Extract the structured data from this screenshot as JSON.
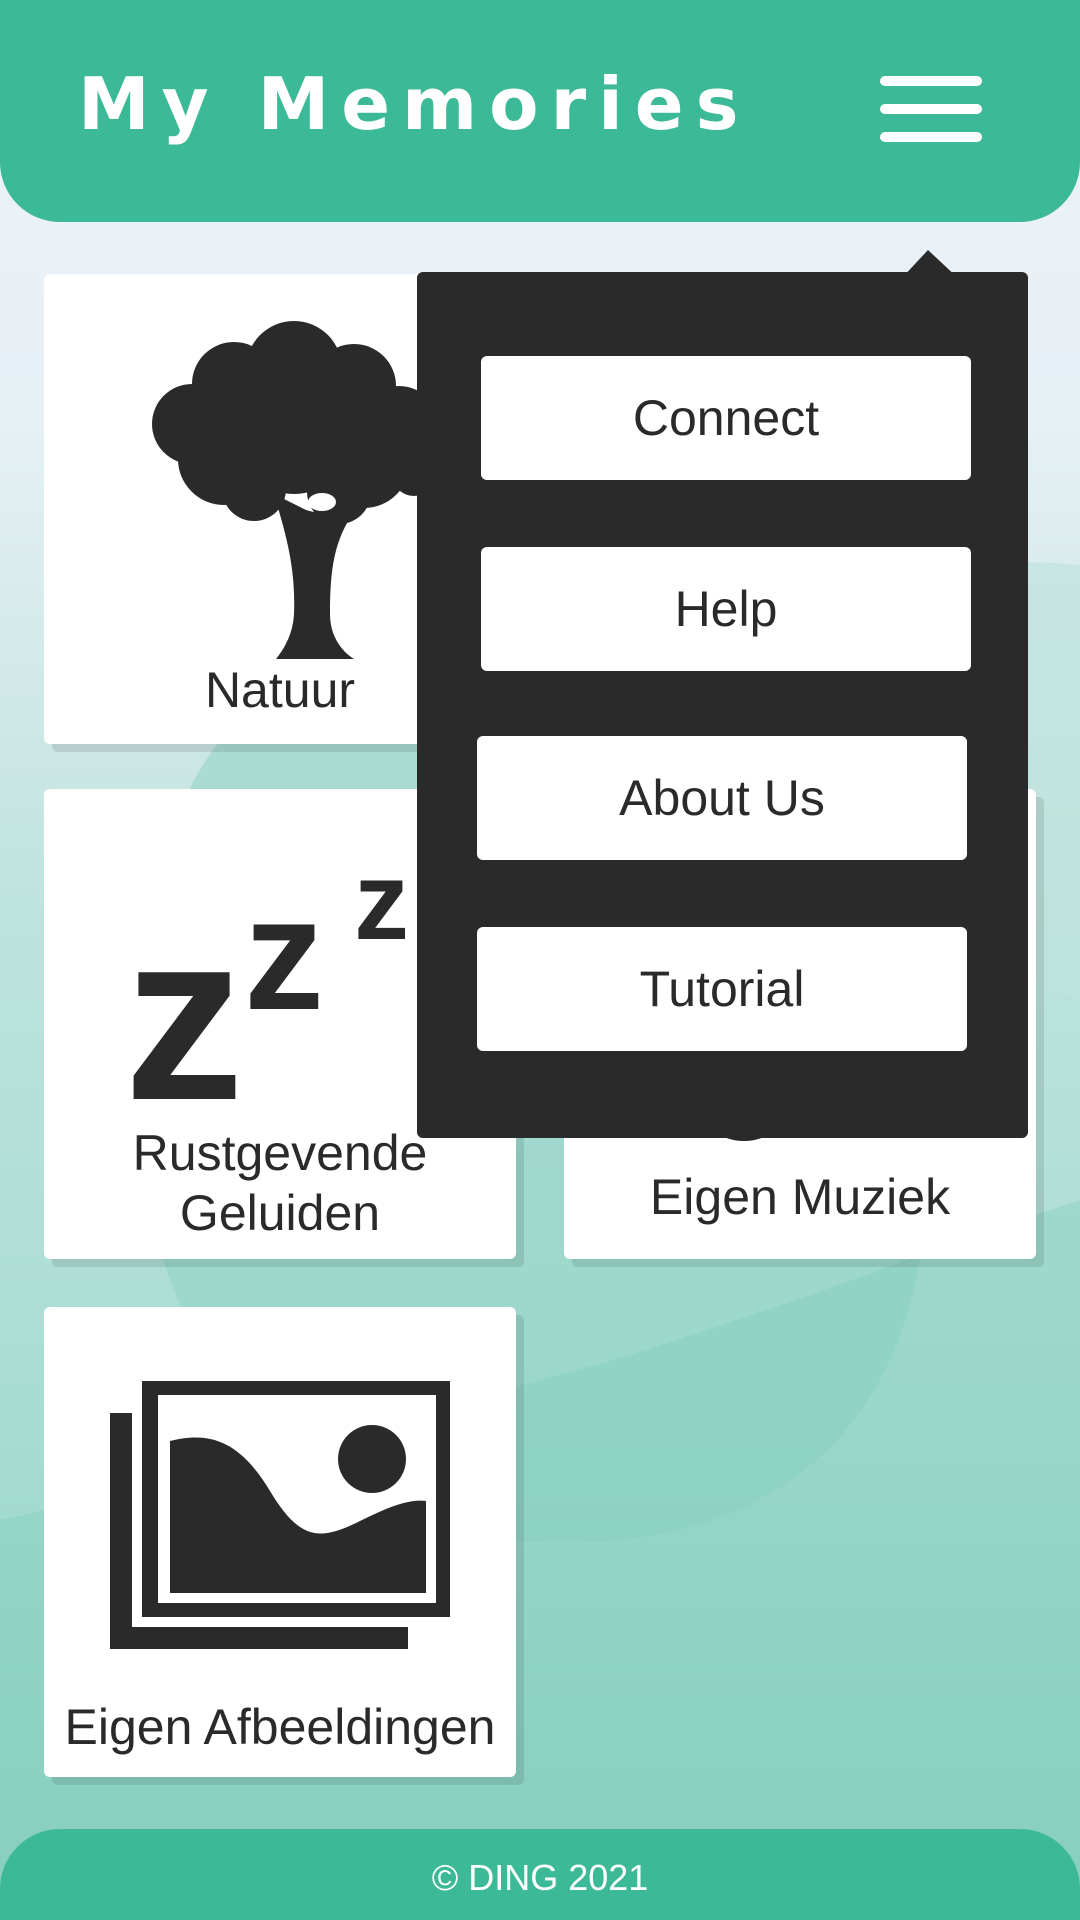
{
  "header": {
    "title": "My Memories",
    "menu_icon": "hamburger-menu-icon"
  },
  "tiles": [
    {
      "label": "Natuur",
      "icon": "tree-icon"
    },
    {
      "label_line1": "Rustgevende",
      "label_line2": "Geluiden",
      "icon": "sleep-zzz-icon"
    },
    {
      "label": "Eigen Muziek",
      "icon": "music-note-icon"
    },
    {
      "label": "Eigen Afbeeldingen",
      "icon": "image-gallery-icon"
    }
  ],
  "menu": {
    "items": [
      {
        "label": "Connect"
      },
      {
        "label": "Help"
      },
      {
        "label": "About Us"
      },
      {
        "label": "Tutorial"
      }
    ]
  },
  "footer": {
    "text": "© DING 2021"
  },
  "colors": {
    "brand": "#3cb996",
    "menu_bg": "#2a2a2a",
    "icon": "#2a2a2a",
    "tile_bg": "#ffffff"
  }
}
